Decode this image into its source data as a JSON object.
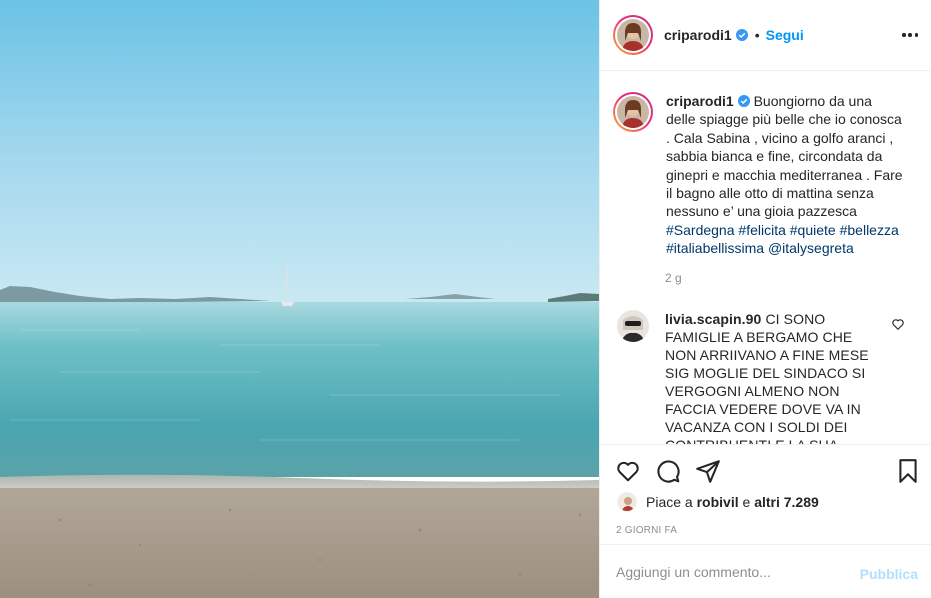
{
  "post": {
    "author": "criparodi1",
    "follow_label": "Segui",
    "dot": "•",
    "caption": {
      "author": "criparodi1",
      "text": "Buongiorno da una delle spiagge più belle che io conosca . Cala Sabina , vicino a golfo aranci , sabbia bianca e fine, circondata da ginepri e macchia mediterranea . Fare il bagno alle otto di mattina senza nessuno e’ una gioia pazzesca",
      "hashtags": [
        "#Sardegna",
        "#felicita",
        "#quiete",
        "#bellezza",
        "#italiabellissima",
        "@italysegreta"
      ]
    },
    "caption_time": "2 g",
    "comment": {
      "author": "livia.scapin.90",
      "text": "CI SONO FAMIGLIE A BERGAMO CHE NON ARRIIVANO A FINE MESE SIG MOGLIE DEL SINDACO SI VERGOGNI ALMENO NON FACCIA VEDERE DOVE VA IN VACANZA CON I SOLDI DEI CONTRIBUENTI E LA SUA PREPARA"
    },
    "likes": {
      "prefix": "Piace a",
      "user": "robivil",
      "joiner": "e",
      "others": "altri 7.289"
    },
    "posted_ago": "2 GIORNI FA",
    "add_comment_placeholder": "Aggiungi un commento...",
    "publish_label": "Pubblica"
  },
  "icons": {
    "verified": "verified-badge-icon",
    "more": "more-options-icon",
    "like": "heart-icon",
    "comment": "comment-icon",
    "share": "share-icon",
    "save": "bookmark-icon",
    "comment_like": "small-heart-icon"
  },
  "colors": {
    "accent": "#0095f6",
    "hashtag": "#00376b",
    "muted": "#8e8e8e",
    "publish_disabled": "#b2dffc"
  }
}
